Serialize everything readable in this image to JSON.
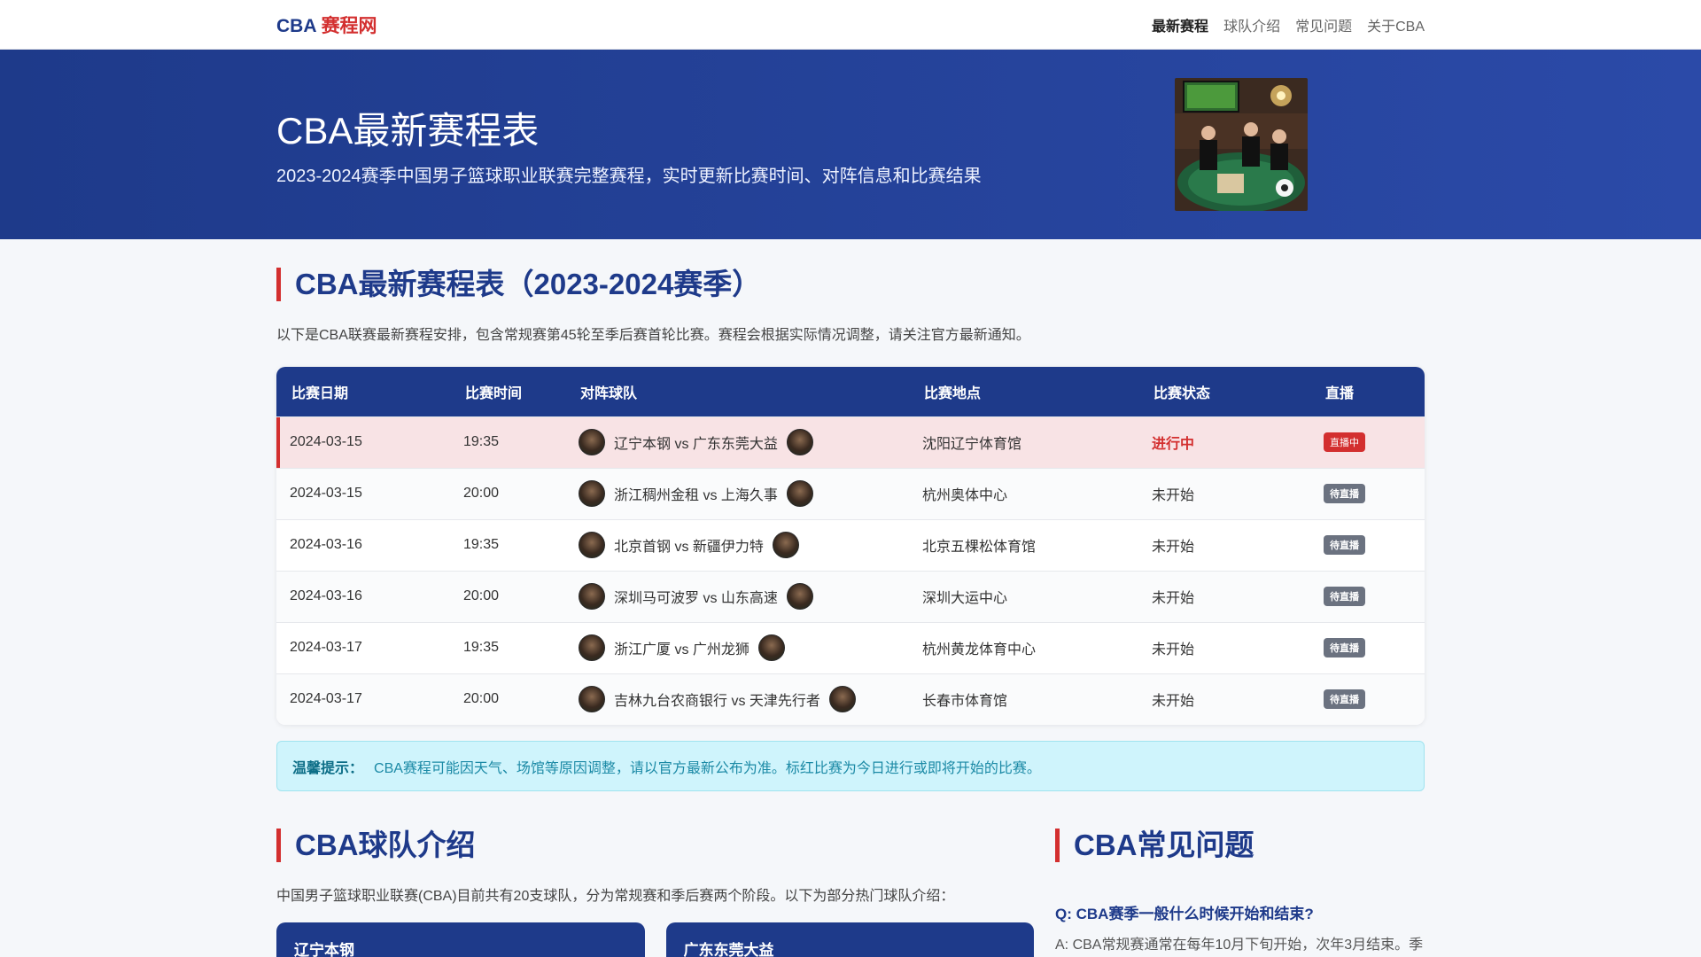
{
  "nav": {
    "brand_prefix": "CBA",
    "brand_suffix": "赛程网",
    "links": [
      "最新赛程",
      "球队介绍",
      "常见问题",
      "关于CBA"
    ]
  },
  "hero": {
    "title": "CBA最新赛程表",
    "subtitle": "2023-2024赛季中国男子篮球职业联赛完整赛程，实时更新比赛时间、对阵信息和比赛结果"
  },
  "schedule": {
    "title": "CBA最新赛程表（2023-2024赛季）",
    "description": "以下是CBA联赛最新赛程安排，包含常规赛第45轮至季后赛首轮比赛。赛程会根据实际情况调整，请关注官方最新通知。",
    "headers": [
      "比赛日期",
      "比赛时间",
      "对阵球队",
      "比赛地点",
      "比赛状态",
      "直播"
    ],
    "rows": [
      {
        "date": "2024-03-15",
        "time": "19:35",
        "teams": "辽宁本钢 vs 广东东莞大益",
        "venue": "沈阳辽宁体育馆",
        "status": "进行中",
        "stream": "直播中"
      },
      {
        "date": "2024-03-15",
        "time": "20:00",
        "teams": "浙江稠州金租 vs 上海久事",
        "venue": "杭州奥体中心",
        "status": "未开始",
        "stream": "待直播"
      },
      {
        "date": "2024-03-16",
        "time": "19:35",
        "teams": "北京首钢 vs 新疆伊力特",
        "venue": "北京五棵松体育馆",
        "status": "未开始",
        "stream": "待直播"
      },
      {
        "date": "2024-03-16",
        "time": "20:00",
        "teams": "深圳马可波罗 vs 山东高速",
        "venue": "深圳大运中心",
        "status": "未开始",
        "stream": "待直播"
      },
      {
        "date": "2024-03-17",
        "time": "19:35",
        "teams": "浙江广厦 vs 广州龙狮",
        "venue": "杭州黄龙体育中心",
        "status": "未开始",
        "stream": "待直播"
      },
      {
        "date": "2024-03-17",
        "time": "20:00",
        "teams": "吉林九台农商银行 vs 天津先行者",
        "venue": "长春市体育馆",
        "status": "未开始",
        "stream": "待直播"
      }
    ]
  },
  "notice": {
    "label": "温馨提示：",
    "text": "CBA赛程可能因天气、场馆等原因调整，请以官方最新公布为准。标红比赛为今日进行或即将开始的比赛。"
  },
  "teams_section": {
    "title": "CBA球队介绍",
    "description": "中国男子篮球职业联赛(CBA)目前共有20支球队，分为常规赛和季后赛两个阶段。以下为部分热门球队介绍：",
    "cards": [
      "辽宁本钢",
      "广东东莞大益"
    ]
  },
  "faq": {
    "title": "CBA常见问题",
    "question": "Q: CBA赛季一般什么时候开始和结束?",
    "answer": "A: CBA常规赛通常在每年10月下旬开始，次年3月结束。季"
  },
  "colors": {
    "primary": "#1e3a8a",
    "accent": "#d32f2f",
    "live_row": "#f8e3e5",
    "notice_bg": "#cff4fc"
  }
}
